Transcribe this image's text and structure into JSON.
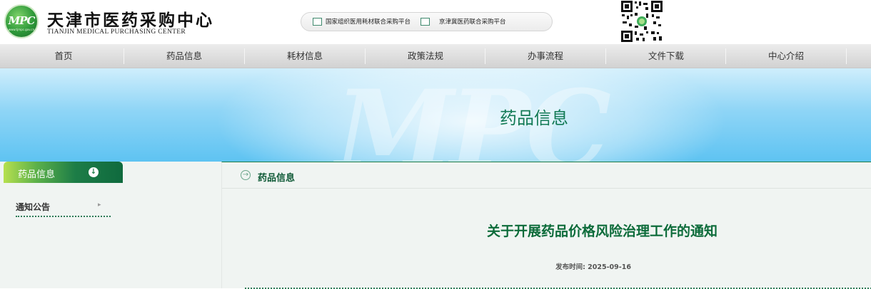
{
  "header": {
    "logo_mark": "MPC",
    "logo_url": "www.tjmpc.gov.cn",
    "org_name_cn": "天津市医药采购中心",
    "org_name_en": "TIANJIN MEDICAL PURCHASING CENTER",
    "platform_links": [
      {
        "label": "国家组织医用耗材联合采购平台"
      },
      {
        "label": "京津冀医药联合采购平台"
      }
    ]
  },
  "nav": {
    "items": [
      {
        "label": "首页"
      },
      {
        "label": "药品信息"
      },
      {
        "label": "耗材信息"
      },
      {
        "label": "政策法规"
      },
      {
        "label": "办事流程"
      },
      {
        "label": "文件下载"
      },
      {
        "label": "中心介绍"
      }
    ]
  },
  "banner": {
    "watermark": "MPC",
    "title": "药品信息"
  },
  "sidebar": {
    "heading": "药品信息",
    "items": [
      {
        "label": "通知公告"
      }
    ]
  },
  "content": {
    "section_title": "药品信息",
    "article_title": "关于开展药品价格风险治理工作的通知",
    "publish_label": "发布时间: 2025-09-16"
  },
  "colors": {
    "brand_green": "#137a55",
    "nav_bg": "#dcdcdc",
    "banner_blue": "#5ec3f2"
  }
}
